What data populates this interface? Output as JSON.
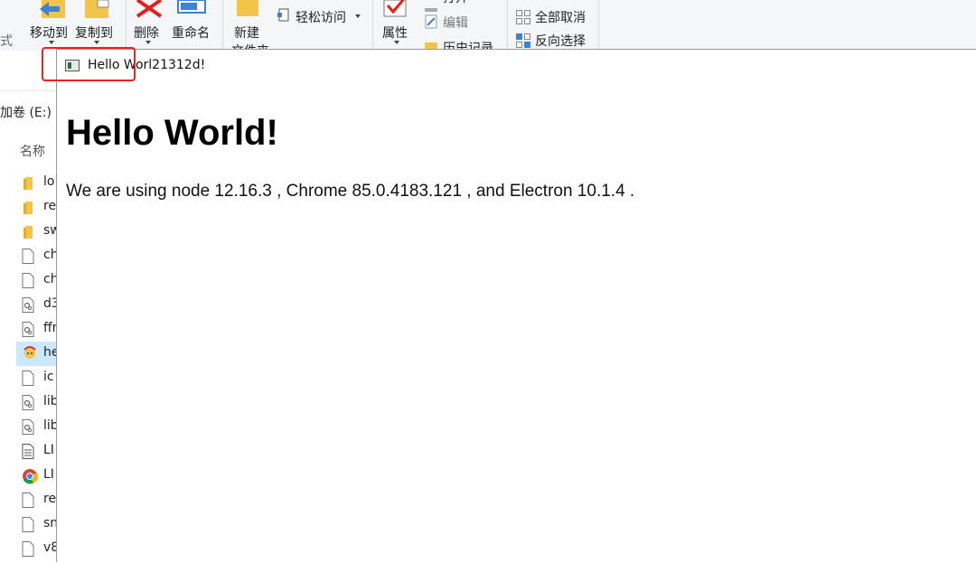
{
  "ribbon": {
    "partial_left": "式",
    "move_to": "移动到",
    "copy_to": "复制到",
    "delete": "删除",
    "rename": "重命名",
    "new": "新建",
    "new_line2": "文件夹",
    "easy_access": "轻松访问",
    "properties": "属性",
    "open": "打开",
    "edit": "编辑",
    "history": "历史记录",
    "select_none": "全部取消",
    "invert_selection": "反向选择"
  },
  "explorer": {
    "address_partial": "加卷 (E:)",
    "column_name": "名称",
    "files": [
      {
        "name": "lo",
        "icon": "folder-icon"
      },
      {
        "name": "re",
        "icon": "folder-icon"
      },
      {
        "name": "sw",
        "icon": "folder-icon"
      },
      {
        "name": "ch",
        "icon": "file-icon"
      },
      {
        "name": "ch",
        "icon": "file-icon"
      },
      {
        "name": "d3",
        "icon": "dll-icon"
      },
      {
        "name": "ffr",
        "icon": "dll-icon"
      },
      {
        "name": "he",
        "icon": "app-icon"
      },
      {
        "name": "ic",
        "icon": "file-icon"
      },
      {
        "name": "lib",
        "icon": "dll-icon"
      },
      {
        "name": "lib",
        "icon": "dll-icon"
      },
      {
        "name": "LI",
        "icon": "text-file-icon"
      },
      {
        "name": "LI",
        "icon": "chrome-icon"
      },
      {
        "name": "re",
        "icon": "file-icon"
      },
      {
        "name": "sn",
        "icon": "file-icon"
      },
      {
        "name": "v8",
        "icon": "file-icon"
      }
    ]
  },
  "window": {
    "title": "Hello Worl21312d!",
    "heading": "Hello World!",
    "paragraph": "We are using node 12.16.3 , Chrome 85.0.4183.121 , and Electron 10.1.4 ."
  },
  "colors": {
    "highlight": "#e8231e",
    "folder": "#f2c44a",
    "delete_red": "#e3201b",
    "accent_blue": "#3b83d6"
  }
}
